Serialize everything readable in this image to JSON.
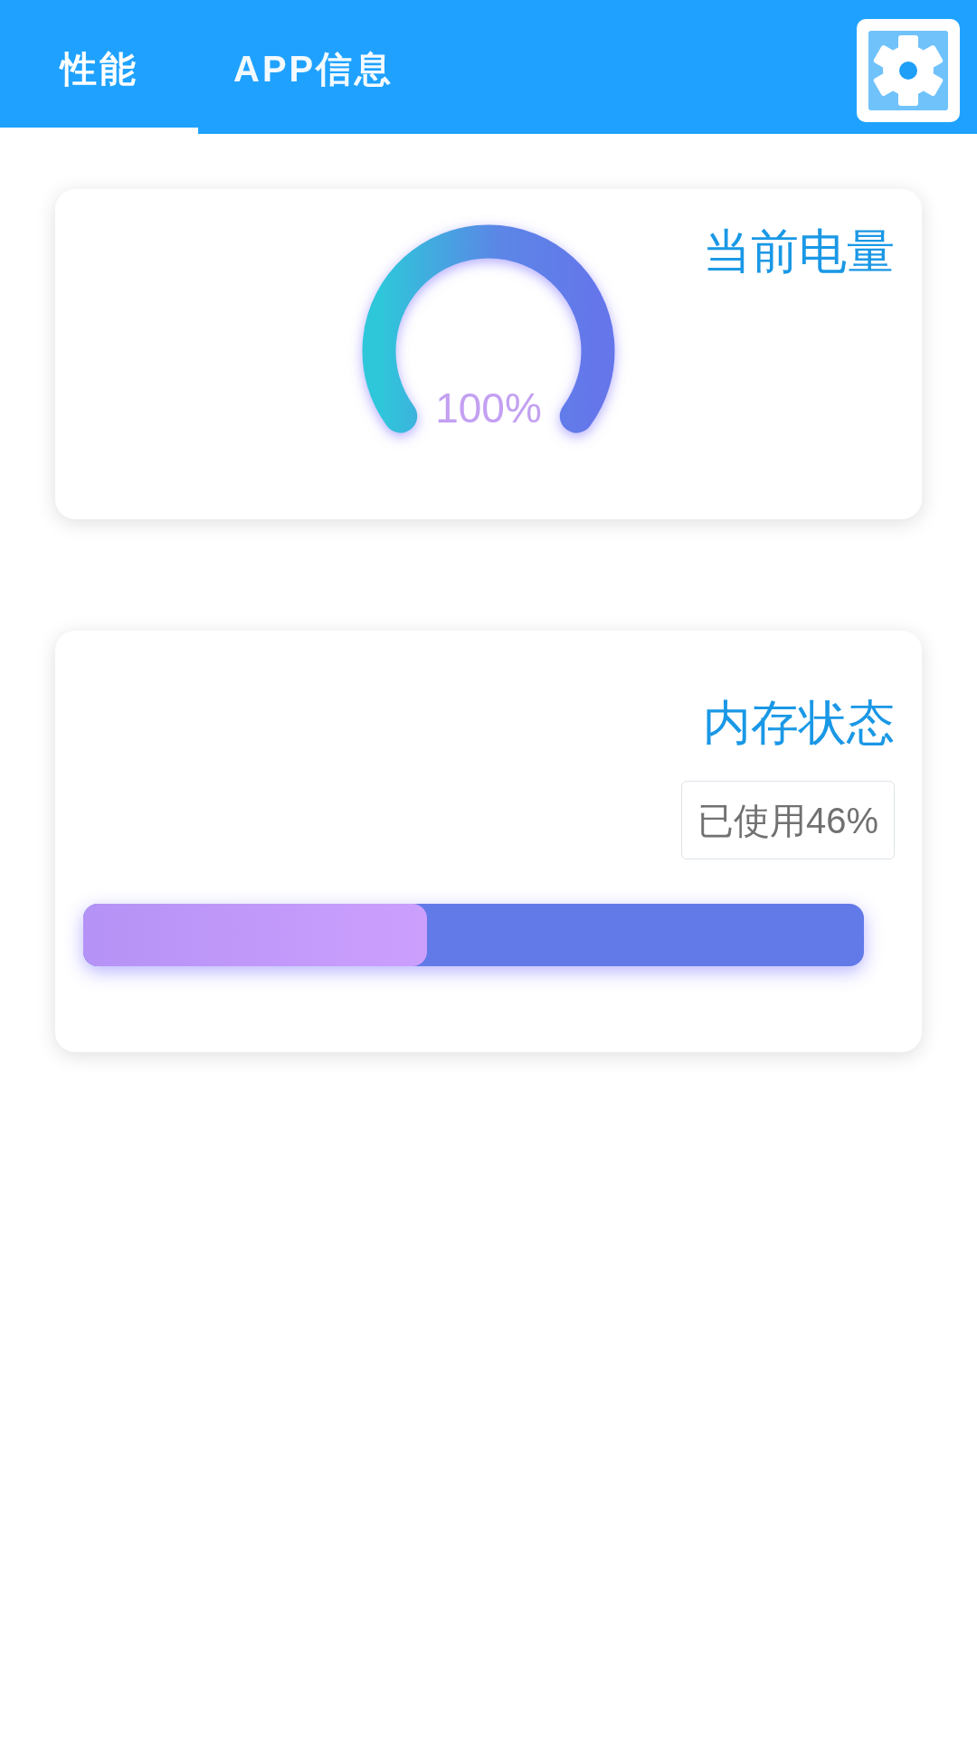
{
  "tabs": [
    {
      "label": "性能",
      "selected": true
    },
    {
      "label": "APP信息",
      "selected": false
    }
  ],
  "battery_card": {
    "title": "当前电量",
    "gauge": {
      "level": 1,
      "reading": "100%"
    }
  },
  "memory_card": {
    "title": "内存状态",
    "badge": "已使用46%",
    "progress": {
      "level": 0.44
    }
  }
}
